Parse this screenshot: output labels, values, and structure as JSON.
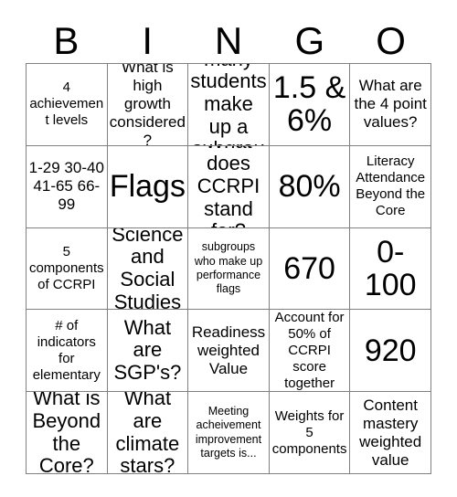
{
  "card": {
    "header_letters": [
      "B",
      "I",
      "N",
      "G",
      "O"
    ],
    "columns": 5,
    "rows": 5,
    "grid_line_color": "#808080",
    "background_color": "#ffffff",
    "text_color": "#000000",
    "cells": [
      {
        "text": "4 achievement levels",
        "size": "sm"
      },
      {
        "text": "What is high growth considered?",
        "size": "md"
      },
      {
        "text": "How many students make up a subgroup?",
        "size": "lg"
      },
      {
        "text": "1.5 & 6%",
        "size": "xl"
      },
      {
        "text": "What are the 4 point values?",
        "size": "md"
      },
      {
        "text": "1-29 30-40 41-65 66-99",
        "size": "md"
      },
      {
        "text": "Flags",
        "size": "xl"
      },
      {
        "text": "What does CCRPI stand for?",
        "size": "lg"
      },
      {
        "text": "80%",
        "size": "xl"
      },
      {
        "text": "Literacy Attendance Beyond the Core",
        "size": "sm"
      },
      {
        "text": "5 components of CCRPI",
        "size": "sm"
      },
      {
        "text": "Science and Social Studies",
        "size": "lg"
      },
      {
        "text": "subgroups who make up performance flags",
        "size": "xs"
      },
      {
        "text": "670",
        "size": "xl"
      },
      {
        "text": "0-100",
        "size": "xl"
      },
      {
        "text": "# of indicators for elementary",
        "size": "sm"
      },
      {
        "text": "What are SGP's?",
        "size": "lg"
      },
      {
        "text": "Readiness weighted Value",
        "size": "md"
      },
      {
        "text": "Account for 50% of CCRPI score together",
        "size": "sm"
      },
      {
        "text": "920",
        "size": "xl"
      },
      {
        "text": "What is Beyond the Core?",
        "size": "lg"
      },
      {
        "text": "What are climate stars?",
        "size": "lg"
      },
      {
        "text": "Meeting acheivement improvement targets is...",
        "size": "xs"
      },
      {
        "text": "Weights for 5 components",
        "size": "sm"
      },
      {
        "text": "Content mastery weighted value",
        "size": "md"
      }
    ]
  }
}
